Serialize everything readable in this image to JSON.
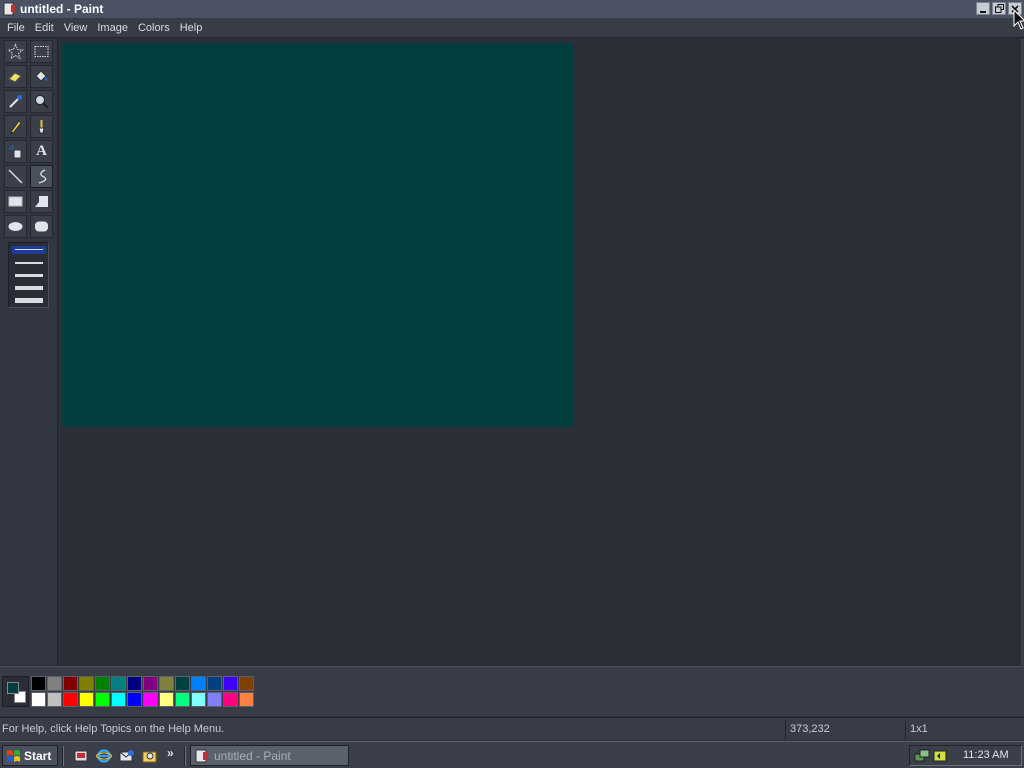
{
  "window": {
    "title": "untitled - Paint",
    "controls": [
      "minimize",
      "restore",
      "close"
    ]
  },
  "menu": [
    "File",
    "Edit",
    "View",
    "Image",
    "Colors",
    "Help"
  ],
  "toolbox": {
    "tools": [
      {
        "name": "free-form-select",
        "icon": "star-select-icon"
      },
      {
        "name": "select",
        "icon": "rect-select-icon"
      },
      {
        "name": "eraser",
        "icon": "eraser-icon"
      },
      {
        "name": "fill-with-color",
        "icon": "paint-bucket-icon"
      },
      {
        "name": "pick-color",
        "icon": "eyedropper-icon"
      },
      {
        "name": "magnifier",
        "icon": "magnifier-icon"
      },
      {
        "name": "pencil",
        "icon": "pencil-icon"
      },
      {
        "name": "brush",
        "icon": "brush-icon"
      },
      {
        "name": "airbrush",
        "icon": "airbrush-icon"
      },
      {
        "name": "text",
        "icon": "text-icon",
        "glyph": "A"
      },
      {
        "name": "line",
        "icon": "line-icon"
      },
      {
        "name": "curve",
        "icon": "curve-icon",
        "active": true
      },
      {
        "name": "rectangle",
        "icon": "rectangle-icon"
      },
      {
        "name": "polygon",
        "icon": "polygon-icon"
      },
      {
        "name": "ellipse",
        "icon": "ellipse-icon"
      },
      {
        "name": "rounded-rectangle",
        "icon": "rounded-rect-icon"
      }
    ],
    "line_width_selected": 1
  },
  "canvas": {
    "fill_color": "#033e3e"
  },
  "palette": {
    "foreground": "#033e3e",
    "background": "#ffffff",
    "colors": [
      "#000000",
      "#808080",
      "#800000",
      "#808000",
      "#008000",
      "#008080",
      "#000080",
      "#800080",
      "#808040",
      "#004040",
      "#0080ff",
      "#004080",
      "#4000ff",
      "#804000",
      "#ffffff",
      "#c0c0c0",
      "#ff0000",
      "#ffff00",
      "#00ff00",
      "#00ffff",
      "#0000ff",
      "#ff00ff",
      "#ffff80",
      "#00ff80",
      "#80ffff",
      "#8080ff",
      "#ff0080",
      "#ff8040"
    ]
  },
  "status": {
    "help": "For Help, click Help Topics on the Help Menu.",
    "coords": "373,232",
    "size": "1x1"
  },
  "taskbar": {
    "start_label": "Start",
    "task_label": "untitled - Paint",
    "more_glyph": "»",
    "clock": "11:23 AM"
  }
}
